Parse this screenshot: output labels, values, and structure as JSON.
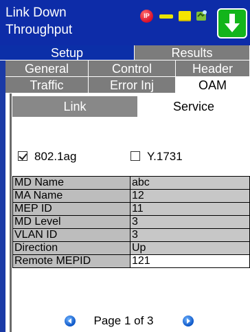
{
  "header": {
    "title_line1": "Link Down",
    "title_line2": "Throughput",
    "status_icons": [
      "ip-icon",
      "link-bar-icon",
      "folder-icon",
      "network-icon"
    ],
    "action_icon": "arrow-down-icon",
    "colors": {
      "title_bg": "#0d2ca8",
      "action_bg": "#13b51b"
    }
  },
  "top_tabs": [
    {
      "label": "Setup",
      "active": true
    },
    {
      "label": "Results",
      "active": false
    }
  ],
  "config_tabs_row1": [
    "General",
    "Control",
    "Header"
  ],
  "config_tabs_row2": [
    {
      "label": "Traffic",
      "active": false
    },
    {
      "label": "Error Inj",
      "active": false
    },
    {
      "label": "OAM",
      "active": true
    }
  ],
  "oam_subtabs": [
    {
      "label": "Link",
      "active": false
    },
    {
      "label": "Service",
      "active": true
    }
  ],
  "protocols": [
    {
      "label": "802.1ag",
      "checked": true
    },
    {
      "label": "Y.1731",
      "checked": false
    }
  ],
  "params": [
    {
      "label": "MD Name",
      "value": "abc"
    },
    {
      "label": "MA Name",
      "value": "12"
    },
    {
      "label": "MEP ID",
      "value": "11"
    },
    {
      "label": "MD Level",
      "value": "3"
    },
    {
      "label": "VLAN ID",
      "value": "3"
    },
    {
      "label": "Direction",
      "value": "Up"
    },
    {
      "label": "Remote MEPID",
      "value": "121"
    }
  ],
  "pager": {
    "text": "Page 1 of 3"
  }
}
